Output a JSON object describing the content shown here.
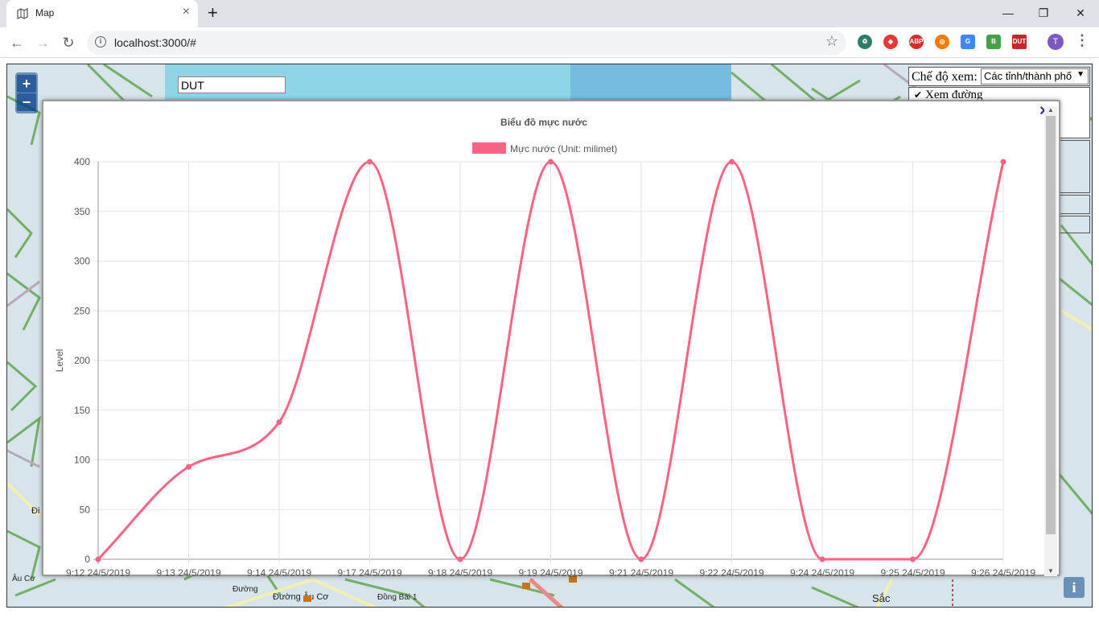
{
  "browser": {
    "tab_title": "Map",
    "tab_close": "×",
    "new_tab": "+",
    "url": "localhost:3000/#",
    "avatar_letter": "T",
    "window_controls": [
      "—",
      "❐",
      "✕"
    ]
  },
  "map": {
    "search_value": "DUT",
    "zoom_in": "+",
    "zoom_out": "−",
    "view_mode_label": "Chế độ xem:",
    "view_mode_selected": "Các tỉnh/thành phố",
    "checkbox_label": "Xem đường",
    "info_button": "i",
    "street_labels": [
      "Đường Âu Cơ",
      "Đường",
      "Đồng Bài 1",
      "Sắc",
      "Âu Cơ",
      "Đi"
    ]
  },
  "modal": {
    "close": "×"
  },
  "chart_data": {
    "type": "line",
    "title": "Biểu đồ mực nước",
    "legend": "Mực nước (Unit: milimet)",
    "legend_position": "top",
    "ylabel": "Level",
    "xlabel": "",
    "ylim": [
      0,
      400
    ],
    "yticks": [
      0,
      50,
      100,
      150,
      200,
      250,
      300,
      350,
      400
    ],
    "grid": true,
    "color": "#ff6384",
    "categories": [
      "9:12 24/5/2019",
      "9:13 24/5/2019",
      "9:14 24/5/2019",
      "9:17 24/5/2019",
      "9:18 24/5/2019",
      "9:19 24/5/2019",
      "9:21 24/5/2019",
      "9:22 24/5/2019",
      "9:24 24/5/2019",
      "9:25 24/5/2019",
      "9:26 24/5/2019"
    ],
    "values": [
      0,
      93,
      138,
      400,
      0,
      400,
      0,
      400,
      0,
      0,
      400
    ]
  }
}
